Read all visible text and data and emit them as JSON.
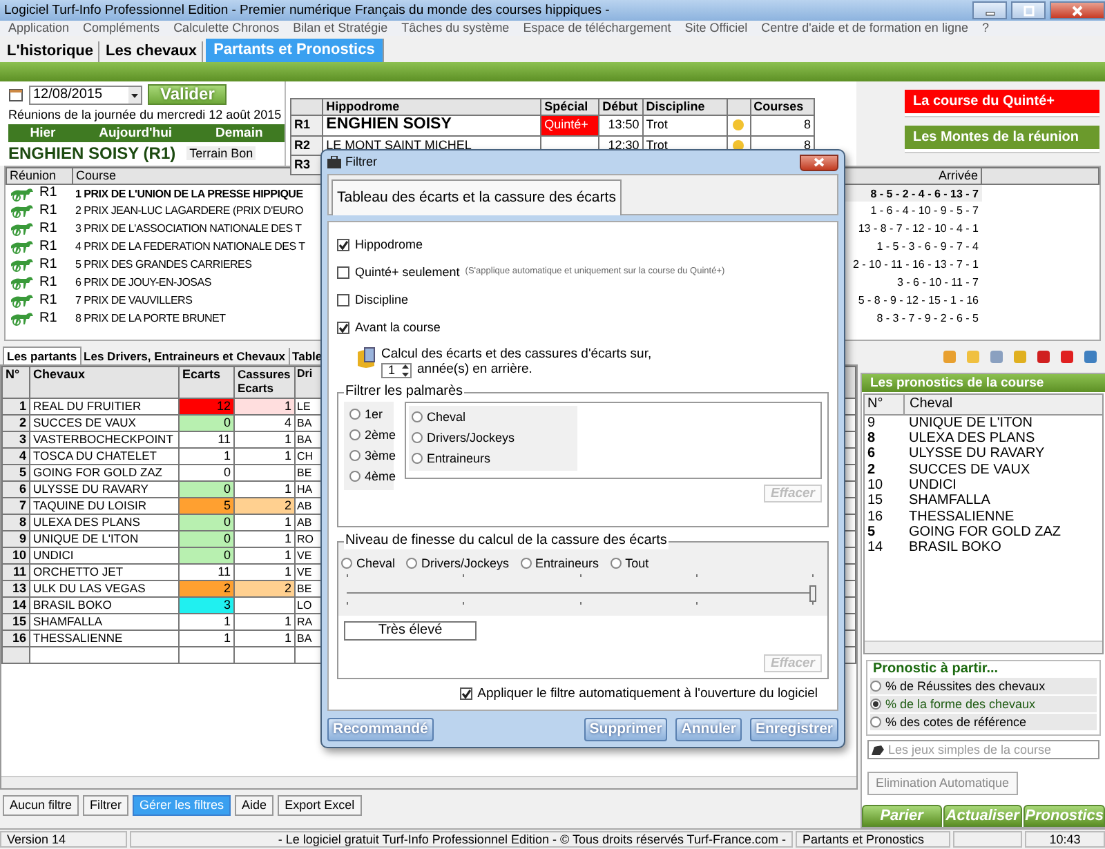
{
  "window": {
    "title": "Logiciel Turf-Info Professionnel Edition - Premier numérique Français du monde des courses hippiques -"
  },
  "menu": [
    "Application",
    "Compléments",
    "Calculette Chronos",
    "Bilan et Stratégie",
    "Tâches du système",
    "Espace de téléchargement",
    "Site Officiel",
    "Centre d'aide et de formation en ligne",
    "?"
  ],
  "main_tabs": [
    {
      "label": "L'historique",
      "selected": false
    },
    {
      "label": "Les chevaux",
      "selected": false
    },
    {
      "label": "Partants et Pronostics",
      "selected": true
    }
  ],
  "date_panel": {
    "date": "12/08/2015",
    "validate": "Valider",
    "caption": "Réunions de la journée du mercredi 12 août 2015",
    "nav": [
      "Hier",
      "Aujourd'hui",
      "Demain"
    ],
    "meeting": "ENGHIEN SOISY (R1)",
    "terrain": "Terrain Bon"
  },
  "meetings": {
    "columns": [
      "Hippodrome",
      "Spécial",
      "Début",
      "Discipline",
      "Courses"
    ],
    "rows": [
      {
        "reunion": "R1",
        "hippodrome": "ENGHIEN SOISY",
        "special": "Quinté+",
        "start": "13:50",
        "discipline": "Trot",
        "color": "#f2c230",
        "courses": "8"
      },
      {
        "reunion": "R2",
        "hippodrome": "LE MONT SAINT MICHEL",
        "start": "12:30",
        "discipline": "Trot",
        "color": "#f2c230",
        "courses": "8"
      },
      {
        "reunion": "R3"
      }
    ]
  },
  "side_buttons": [
    {
      "label": "La course du Quinté+",
      "color": "#ff0000"
    },
    {
      "label": "Les Montes de la réunion",
      "color": "#6b9a2c"
    }
  ],
  "courses": {
    "columns": [
      "Réunion",
      "Course",
      "Arrivée"
    ],
    "rows": [
      {
        "reunion": "R1",
        "course": "1 PRIX DE L'UNION DE LA PRESSE HIPPIQUE",
        "arrivee": "8 - 5 - 2 - 4 - 6 - 13 - 7",
        "selected": true
      },
      {
        "reunion": "R1",
        "course": "2 PRIX JEAN-LUC LAGARDERE (PRIX D'EURO",
        "arrivee": "1 - 6 - 4 - 10 - 9 - 5 - 7",
        "selected": false
      },
      {
        "reunion": "R1",
        "course": "3 PRIX DE L'ASSOCIATION NATIONALE DES T",
        "arrivee": "13 - 8 - 7 - 12 - 10 - 4 - 1",
        "selected": false
      },
      {
        "reunion": "R1",
        "course": "4 PRIX DE LA FEDERATION NATIONALE DES T",
        "arrivee": "1 - 5 - 3 - 6 - 9 - 7 - 4",
        "selected": false
      },
      {
        "reunion": "R1",
        "course": "5 PRIX DES GRANDES CARRIERES",
        "arrivee": "2 - 10 - 11 - 16 - 13 - 7 - 1",
        "selected": false
      },
      {
        "reunion": "R1",
        "course": "6 PRIX DE JOUY-EN-JOSAS",
        "arrivee": "3 - 6 - 10 - 11 - 7",
        "selected": false
      },
      {
        "reunion": "R1",
        "course": "7 PRIX DE VAUVILLERS",
        "arrivee": "5 - 8 - 9 - 12 - 15 - 1 - 16",
        "selected": false
      },
      {
        "reunion": "R1",
        "course": "8 PRIX DE LA PORTE BRUNET",
        "arrivee": "8 - 3 - 7 - 9 - 2 - 6 - 5",
        "selected": false
      }
    ]
  },
  "sub_tabs": [
    {
      "label": "Les partants",
      "selected": true
    },
    {
      "label": "Les Drivers, Entraineurs et Chevaux",
      "selected": false
    },
    {
      "label": "Table",
      "selected": false
    }
  ],
  "runners": {
    "columns": [
      "N°",
      "Chevaux",
      "Ecarts",
      "Cassures Ecarts",
      "Dri"
    ],
    "rows": [
      {
        "num": "1",
        "name": "REAL DU FRUITIER",
        "ecarts": {
          "text": "12",
          "color": "#ff0000"
        },
        "cassures": {
          "text": "1",
          "color": "#ffdede"
        },
        "driver": "LE"
      },
      {
        "num": "2",
        "name": "SUCCES DE VAUX",
        "ecarts": {
          "text": "0",
          "color": "#b8f0b0"
        },
        "cassures": {
          "text": "4"
        },
        "driver": "BA"
      },
      {
        "num": "3",
        "name": "VASTERBOCHECKPOINT",
        "ecarts": {
          "text": "11"
        },
        "cassures": {
          "text": "1"
        },
        "driver": "BA"
      },
      {
        "num": "4",
        "name": "TOSCA DU CHATELET",
        "ecarts": {
          "text": "1"
        },
        "cassures": {
          "text": "1"
        },
        "driver": "CH"
      },
      {
        "num": "5",
        "name": "GOING FOR GOLD ZAZ",
        "ecarts": {
          "text": "0"
        },
        "driver": "BE"
      },
      {
        "num": "6",
        "name": "ULYSSE DU RAVARY",
        "ecarts": {
          "text": "0",
          "color": "#b8f0b0"
        },
        "cassures": {
          "text": "1"
        },
        "driver": "HA"
      },
      {
        "num": "7",
        "name": "TAQUINE DU LOISIR",
        "ecarts": {
          "text": "5",
          "color": "#ffa030"
        },
        "cassures": {
          "text": "2",
          "color": "#ffd090"
        },
        "driver": "AB"
      },
      {
        "num": "8",
        "name": "ULEXA DES PLANS",
        "ecarts": {
          "text": "0",
          "color": "#b8f0b0"
        },
        "cassures": {
          "text": "1"
        },
        "driver": "AB"
      },
      {
        "num": "9",
        "name": "UNIQUE DE L'ITON",
        "ecarts": {
          "text": "0",
          "color": "#b8f0b0"
        },
        "cassures": {
          "text": "1"
        },
        "driver": "RO"
      },
      {
        "num": "10",
        "name": "UNDICI",
        "ecarts": {
          "text": "0",
          "color": "#b8f0b0"
        },
        "cassures": {
          "text": "1"
        },
        "driver": "VE"
      },
      {
        "num": "11",
        "name": "ORCHETTO JET",
        "ecarts": {
          "text": "11"
        },
        "cassures": {
          "text": "1"
        },
        "driver": "VE"
      },
      {
        "num": "13",
        "name": "ULK DU LAS VEGAS",
        "ecarts": {
          "text": "2",
          "color": "#ffa030"
        },
        "cassures": {
          "text": "2",
          "color": "#ffd090"
        },
        "driver": "BE"
      },
      {
        "num": "14",
        "name": "BRASIL BOKO",
        "ecarts": {
          "text": "3",
          "color": "#20f0f0"
        },
        "driver": "LO"
      },
      {
        "num": "15",
        "name": "SHAMFALLA",
        "ecarts": {
          "text": "1"
        },
        "cassures": {
          "text": "1"
        },
        "driver": "RA"
      },
      {
        "num": "16",
        "name": "THESSALIENNE",
        "ecarts": {
          "text": "1"
        },
        "cassures": {
          "text": "1"
        },
        "driver": "BA"
      }
    ]
  },
  "filter_buttons": [
    {
      "label": "Aucun filtre",
      "selected": false
    },
    {
      "label": "Filtrer",
      "selected": false
    },
    {
      "label": "Gérer les filtres",
      "selected": true
    },
    {
      "label": "Aide",
      "selected": false
    },
    {
      "label": "Export Excel",
      "selected": false
    }
  ],
  "forecast": {
    "title": "Les pronostics de la course",
    "columns": [
      "N°",
      "Cheval"
    ],
    "rows": [
      {
        "num": "9",
        "name": "UNIQUE DE L'ITON",
        "bold": false
      },
      {
        "num": "8",
        "name": "ULEXA DES PLANS",
        "bold": true
      },
      {
        "num": "6",
        "name": "ULYSSE DU RAVARY",
        "bold": true
      },
      {
        "num": "2",
        "name": "SUCCES DE VAUX",
        "bold": true
      },
      {
        "num": "10",
        "name": "UNDICI",
        "bold": false
      },
      {
        "num": "15",
        "name": "SHAMFALLA",
        "bold": false
      },
      {
        "num": "16",
        "name": "THESSALIENNE",
        "bold": false
      },
      {
        "num": "5",
        "name": "GOING FOR GOLD ZAZ",
        "bold": true
      },
      {
        "num": "14",
        "name": "BRASIL BOKO",
        "bold": false
      }
    ],
    "source_title": "Pronostic à partir...",
    "source_options": [
      {
        "label": "% de Réussites des chevaux",
        "selected": false
      },
      {
        "label": "% de la forme des chevaux",
        "selected": true
      },
      {
        "label": "% des cotes de référence",
        "selected": false
      }
    ],
    "search_placeholder": "Les jeux simples de la course",
    "elimination": "Elimination Automatique",
    "actions": [
      "Parier",
      "Actualiser",
      "Pronostics"
    ]
  },
  "status_bar": [
    "Version 14",
    "- Le logiciel gratuit Turf-Info Professionnel Edition - © Tous droits réservés Turf-France.com -",
    "Partants et Pronostics",
    "10:43"
  ],
  "dialog": {
    "title": "Filtrer",
    "tab": "Tableau des écarts et la cassure des écarts",
    "checks": [
      {
        "label": "Hippodrome",
        "checked": true
      },
      {
        "label": "Quinté+ seulement",
        "note": "(S'applique automatique et uniquement sur la course du Quinté+)",
        "checked": false
      },
      {
        "label": "Discipline",
        "checked": false
      },
      {
        "label": "Avant la course",
        "checked": true
      }
    ],
    "period_text": "Calcul des écarts et des cassures d'écarts sur,",
    "period_value": "1",
    "period_unit": "année(s) en arrière.",
    "palmares": {
      "title": "Filtrer les palmarès",
      "places": [
        {
          "label": "1er",
          "selected": false
        },
        {
          "label": "2ème",
          "selected": false
        },
        {
          "label": "3ème",
          "selected": false
        },
        {
          "label": "4ème",
          "selected": false
        }
      ],
      "targets": [
        {
          "label": "Cheval",
          "selected": false
        },
        {
          "label": "Drivers/Jockeys",
          "selected": false
        },
        {
          "label": "Entraineurs",
          "selected": false
        }
      ],
      "clear": "Effacer"
    },
    "finesse": {
      "title": "Niveau de finesse du calcul de la cassure des écarts",
      "options": [
        {
          "label": "Cheval",
          "selected": false
        },
        {
          "label": "Drivers/Jockeys",
          "selected": false
        },
        {
          "label": "Entraineurs",
          "selected": false
        },
        {
          "label": "Tout",
          "selected": false
        }
      ],
      "level": 1,
      "reading": "Très élevé",
      "clear": "Effacer"
    },
    "auto_apply": {
      "label": "Appliquer le filtre automatiquement à l'ouverture du logiciel",
      "checked": true
    },
    "buttons": [
      "Recommandé",
      "Supprimer",
      "Annuler",
      "Enregistrer"
    ]
  }
}
